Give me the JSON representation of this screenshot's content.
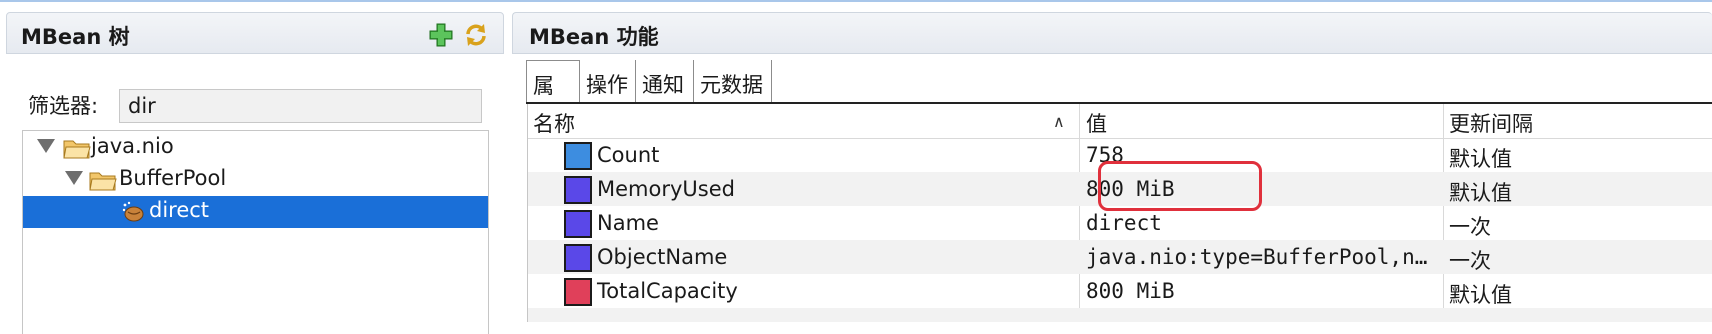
{
  "left_panel": {
    "title": "MBean 树",
    "filter_label": "筛选器:",
    "filter_value": "dir",
    "tree": [
      {
        "label": "java.nio",
        "expanded": true
      },
      {
        "label": "BufferPool",
        "expanded": true
      },
      {
        "label": "direct",
        "selected": true
      }
    ]
  },
  "right_panel": {
    "title": "MBean 功能",
    "tabs": [
      {
        "label": "属性",
        "active": true
      },
      {
        "label": "操作"
      },
      {
        "label": "通知"
      },
      {
        "label": "元数据"
      }
    ],
    "columns": {
      "name": "名称",
      "value": "值",
      "refresh": "更新间隔"
    },
    "rows": [
      {
        "name": "Count",
        "value": "758",
        "refresh": "默认值",
        "color": "#3d8de0"
      },
      {
        "name": "MemoryUsed",
        "value": "800 MiB",
        "refresh": "默认值",
        "color": "#5a48e8"
      },
      {
        "name": "Name",
        "value": "direct",
        "refresh": "一次",
        "color": "#5a48e8"
      },
      {
        "name": "ObjectName",
        "value": "java.nio:type=BufferPool,n…",
        "refresh": "一次",
        "color": "#5a48e8"
      },
      {
        "name": "TotalCapacity",
        "value": "800 MiB",
        "refresh": "默认值",
        "color": "#e0405a"
      }
    ]
  },
  "icons": {
    "add": "plus-icon",
    "refresh": "refresh-icon",
    "folder": "folder-icon",
    "bean": "bean-icon",
    "sort": "sort-ascending-icon"
  },
  "colors": {
    "selection": "#1a6fd8",
    "highlight": "#e0303c"
  }
}
